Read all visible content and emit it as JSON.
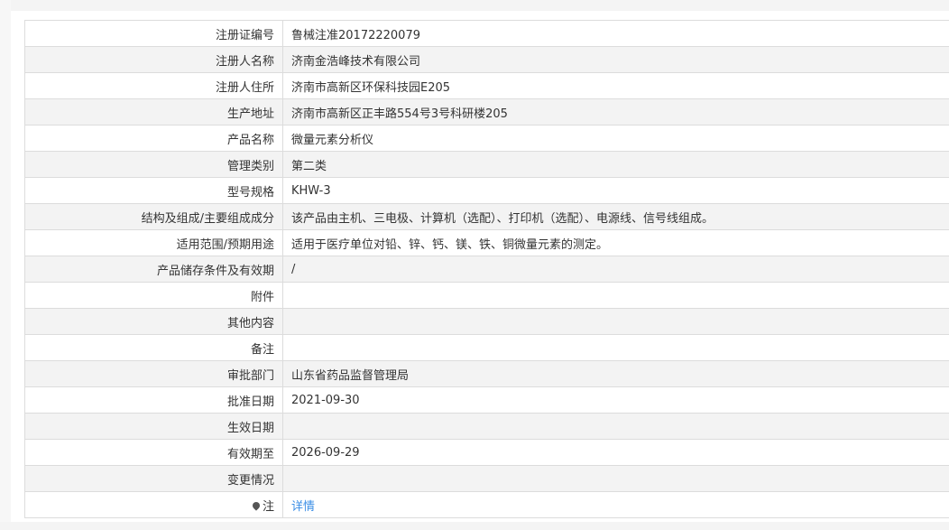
{
  "rows": [
    {
      "label": "注册证编号",
      "value": "鲁械注准20172220079"
    },
    {
      "label": "注册人名称",
      "value": "济南金浩峰技术有限公司"
    },
    {
      "label": "注册人住所",
      "value": "济南市高新区环保科技园E205"
    },
    {
      "label": "生产地址",
      "value": "济南市高新区正丰路554号3号科研楼205"
    },
    {
      "label": "产品名称",
      "value": "微量元素分析仪"
    },
    {
      "label": "管理类别",
      "value": "第二类"
    },
    {
      "label": "型号规格",
      "value": "KHW-3"
    },
    {
      "label": "结构及组成/主要组成成分",
      "value": "该产品由主机、三电极、计算机（选配）、打印机（选配）、电源线、信号线组成。"
    },
    {
      "label": "适用范围/预期用途",
      "value": "适用于医疗单位对铅、锌、钙、镁、铁、铜微量元素的测定。"
    },
    {
      "label": "产品储存条件及有效期",
      "value": "/"
    },
    {
      "label": "附件",
      "value": ""
    },
    {
      "label": "其他内容",
      "value": ""
    },
    {
      "label": "备注",
      "value": ""
    },
    {
      "label": "审批部门",
      "value": "山东省药品监督管理局"
    },
    {
      "label": "批准日期",
      "value": "2021-09-30"
    },
    {
      "label": "生效日期",
      "value": ""
    },
    {
      "label": "有效期至",
      "value": "2026-09-29"
    },
    {
      "label": "变更情况",
      "value": ""
    }
  ],
  "note_row": {
    "icon": "pin-icon",
    "label": "注",
    "link_text": "详情"
  },
  "colors": {
    "border": "#dcdcdc",
    "stripe": "#f3f3f3",
    "link": "#3a8ee6"
  }
}
